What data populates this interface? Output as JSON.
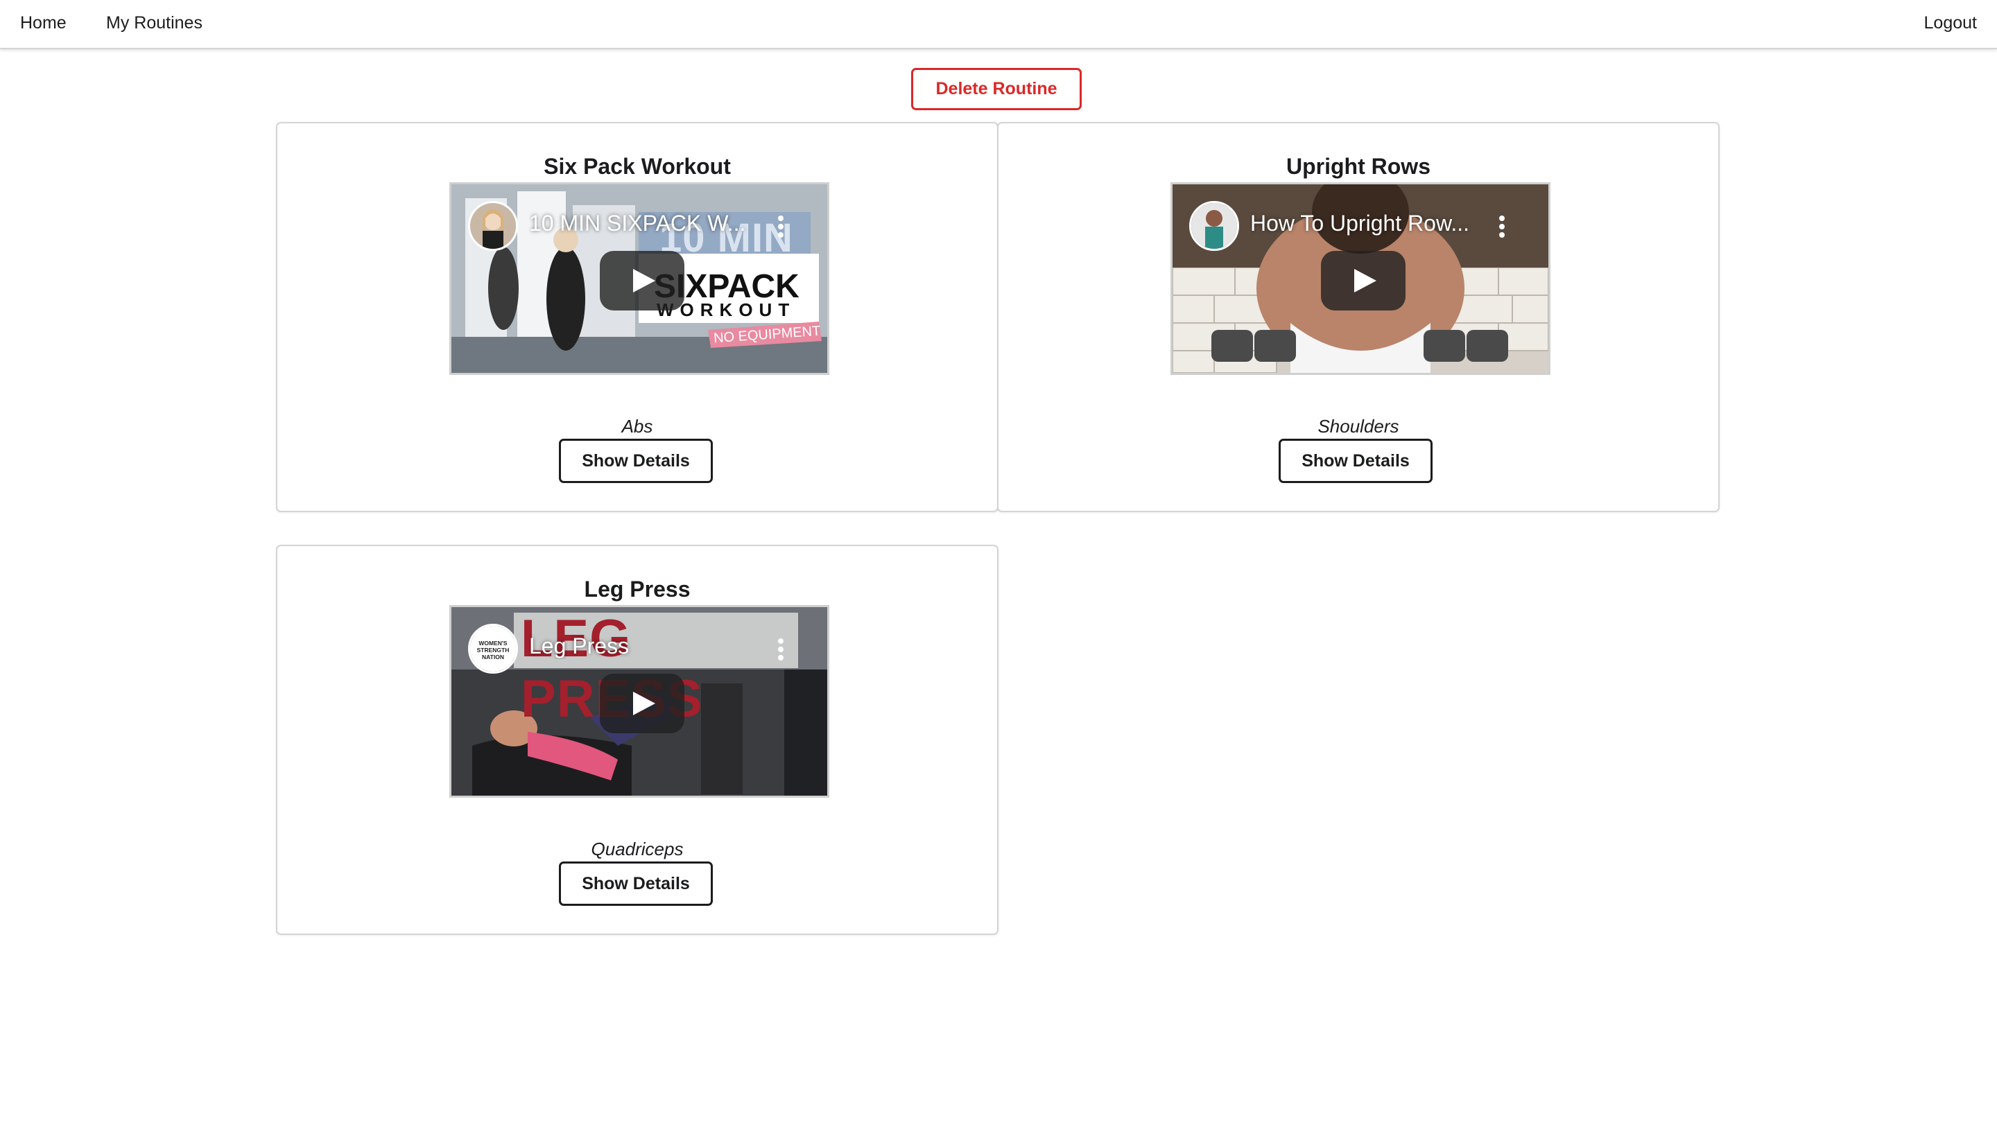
{
  "nav": {
    "home": "Home",
    "my_routines": "My Routines",
    "logout": "Logout"
  },
  "actions": {
    "delete_routine": "Delete Routine"
  },
  "routines": [
    {
      "title": "Six Pack Workout",
      "video_title": "10 MIN SIXPACK W...",
      "category": "Abs",
      "button": "Show Details",
      "thumb_text": [
        "10 MIN",
        "SIXPACK",
        "WORKOUT",
        "NO EQUIPMENT"
      ]
    },
    {
      "title": "Upright Rows",
      "video_title": "How To Upright Row...",
      "category": "Shoulders",
      "button": "Show Details"
    },
    {
      "title": "Leg Press",
      "video_title": "Leg Press",
      "category": "Quadriceps",
      "button": "Show Details",
      "thumb_text": [
        "LEG PRESS"
      ],
      "avatar_text": "WOMEN'S STRENGTH NATION"
    }
  ],
  "colors": {
    "danger": "#db2828",
    "text": "#1b1c1d",
    "border": "#d4d4d5"
  },
  "icons": [
    "play-icon",
    "more-vertical-icon",
    "channel-avatar"
  ]
}
